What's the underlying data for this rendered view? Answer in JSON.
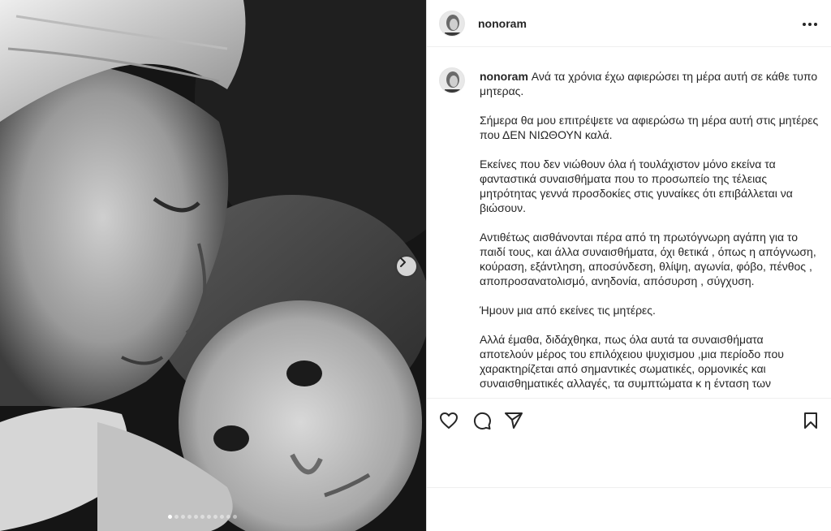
{
  "post": {
    "username": "nonoram",
    "caption_user": "nonoram",
    "paragraphs": [
      "Ανά τα χρόνια έχω αφιερώσει τη μέρα αυτή σε κάθε τυπο μητερας.",
      "Σήμερα θα μου επιτρέψετε να αφιερώσω τη μέρα αυτή στις μητέρες που ΔΕΝ ΝΙΩΘΟΥΝ καλά.",
      "Εκείνες που δεν νιώθουν όλα ή τουλάχιστον μόνο εκείνα τα φανταστικά συναισθήματα που το προσωπείο της τέλειας μητρότητας γεννά προσδοκίες στις γυναίκες ότι επιβάλλεται να βιώσουν.",
      "Αντιθέτως αισθάνονται πέρα από τη πρωτόγνωρη αγάπη για το παιδί τους, και άλλα συναισθήματα, όχι θετικά , όπως η απόγνωση, κούραση, εξάντληση, αποσύνδεση, θλίψη, αγωνία, φόβο, πένθος , αποπροσανατολισμό, ανηδονία, απόσυρση , σύγχυση.",
      "Ήμουν μια από εκείνες τις μητέρες.",
      "Αλλά έμαθα, διδάχθηκα, πως όλα αυτά τα συναισθήματα αποτελούν μέρος του επιλόχειου ψυχισμου ,μια περίοδο που χαρακτηρίζεται από σημαντικές σωματικές, ορμονικές και συναισθηματικές αλλαγές, τα συμπτώματα κ η ένταση των"
    ]
  },
  "carousel": {
    "total": 11,
    "active_index": 0
  },
  "icons": {
    "more": "more-horizontal-icon",
    "next": "chevron-right-icon",
    "like": "heart-icon",
    "comment": "comment-icon",
    "share": "paper-plane-icon",
    "save": "bookmark-icon"
  }
}
